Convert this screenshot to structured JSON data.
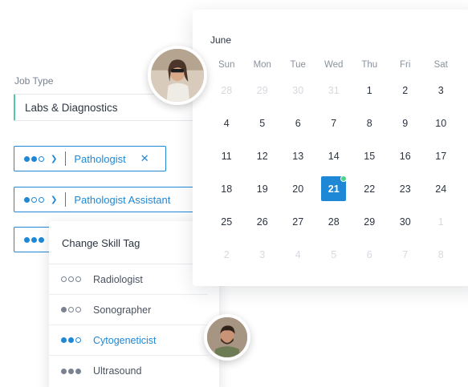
{
  "job_type": {
    "label": "Job Type",
    "value": "Labs & Diagnostics"
  },
  "tags": [
    {
      "label": "Pathologist",
      "level": 2,
      "remove": "✕"
    },
    {
      "label": "Pathologist Assistant",
      "level": 1
    },
    {
      "label": "",
      "level": 3
    }
  ],
  "dropdown": {
    "title": "Change Skill Tag",
    "items": [
      {
        "label": "Radiologist",
        "level": 0
      },
      {
        "label": "Sonographer",
        "level": 1
      },
      {
        "label": "Cytogeneticist",
        "level": 2,
        "selected": true
      },
      {
        "label": "Ultrasound",
        "level": 3
      }
    ]
  },
  "calendar": {
    "month": "June",
    "weekdays": [
      "Sun",
      "Mon",
      "Tue",
      "Wed",
      "Thu",
      "Fri",
      "Sat"
    ],
    "weeks": [
      [
        {
          "d": "28",
          "m": true
        },
        {
          "d": "29",
          "m": true
        },
        {
          "d": "30",
          "m": true
        },
        {
          "d": "31",
          "m": true
        },
        {
          "d": "1"
        },
        {
          "d": "2"
        },
        {
          "d": "3"
        }
      ],
      [
        {
          "d": "4"
        },
        {
          "d": "5"
        },
        {
          "d": "6"
        },
        {
          "d": "7"
        },
        {
          "d": "8"
        },
        {
          "d": "9"
        },
        {
          "d": "10"
        }
      ],
      [
        {
          "d": "11"
        },
        {
          "d": "12"
        },
        {
          "d": "13"
        },
        {
          "d": "14"
        },
        {
          "d": "15"
        },
        {
          "d": "16"
        },
        {
          "d": "17"
        }
      ],
      [
        {
          "d": "18"
        },
        {
          "d": "19"
        },
        {
          "d": "20"
        },
        {
          "d": "21",
          "today": true
        },
        {
          "d": "22"
        },
        {
          "d": "23"
        },
        {
          "d": "24"
        }
      ],
      [
        {
          "d": "25"
        },
        {
          "d": "26"
        },
        {
          "d": "27"
        },
        {
          "d": "28"
        },
        {
          "d": "29"
        },
        {
          "d": "30"
        },
        {
          "d": "1",
          "m": true
        }
      ],
      [
        {
          "d": "2",
          "m": true
        },
        {
          "d": "3",
          "m": true
        },
        {
          "d": "4",
          "m": true
        },
        {
          "d": "5",
          "m": true
        },
        {
          "d": "6",
          "m": true
        },
        {
          "d": "7",
          "m": true
        },
        {
          "d": "8",
          "m": true
        }
      ]
    ]
  },
  "colors": {
    "accent": "#1e88d6",
    "green": "#54c6a8",
    "today_dot": "#4cd08a"
  }
}
